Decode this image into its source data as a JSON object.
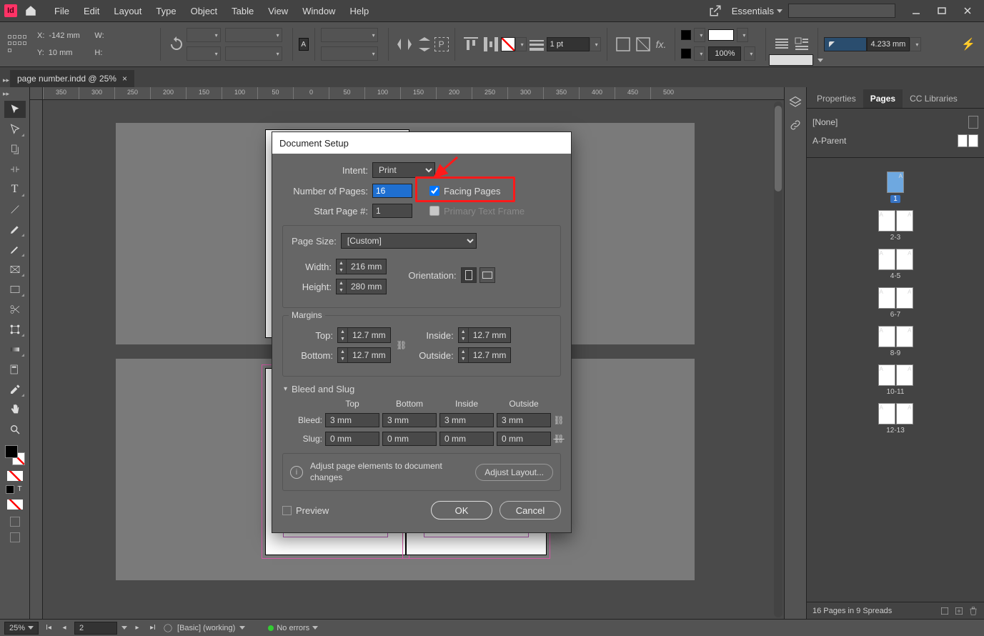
{
  "app": {
    "id_badge": "Id"
  },
  "menu": [
    "File",
    "Edit",
    "Layout",
    "Type",
    "Object",
    "Table",
    "View",
    "Window",
    "Help"
  ],
  "workspace": {
    "label": "Essentials"
  },
  "optbar": {
    "x_lbl": "X:",
    "x_val": "-142 mm",
    "y_lbl": "Y:",
    "y_val": "10 mm",
    "w_lbl": "W:",
    "w_val": "",
    "h_lbl": "H:",
    "h_val": "",
    "stroke": "1 pt",
    "zoom": "100%",
    "num": "4.233 mm"
  },
  "doc_tab": {
    "title": "page number.indd @ 25%"
  },
  "ruler_ticks": [
    "350",
    "300",
    "250",
    "200",
    "150",
    "100",
    "50",
    "0",
    "50",
    "100",
    "150",
    "200",
    "250",
    "300",
    "350",
    "400",
    "450",
    "500"
  ],
  "dialog": {
    "title": "Document Setup",
    "intent_lbl": "Intent:",
    "intent": "Print",
    "npages_lbl": "Number of Pages:",
    "npages": "16",
    "facing_lbl": "Facing Pages",
    "start_lbl": "Start Page #:",
    "start": "1",
    "ptf_lbl": "Primary Text Frame",
    "psize_legend": "Page Size:",
    "psize": "[Custom]",
    "width_lbl": "Width:",
    "width": "216 mm",
    "height_lbl": "Height:",
    "height": "280 mm",
    "orient_lbl": "Orientation:",
    "margins_legend": "Margins",
    "top_lbl": "Top:",
    "top": "12.7 mm",
    "bottom_lbl": "Bottom:",
    "bottom": "12.7 mm",
    "inside_lbl": "Inside:",
    "inside": "12.7 mm",
    "outside_lbl": "Outside:",
    "outside": "12.7 mm",
    "bs_legend": "Bleed and Slug",
    "bs_top": "Top",
    "bs_bottom": "Bottom",
    "bs_inside": "Inside",
    "bs_outside": "Outside",
    "bleed_lbl": "Bleed:",
    "bleed_t": "3 mm",
    "bleed_b": "3 mm",
    "bleed_i": "3 mm",
    "bleed_o": "3 mm",
    "slug_lbl": "Slug:",
    "slug_t": "0 mm",
    "slug_b": "0 mm",
    "slug_i": "0 mm",
    "slug_o": "0 mm",
    "adjust_text": "Adjust page elements to document changes",
    "adjust_btn": "Adjust Layout...",
    "preview": "Preview",
    "ok": "OK",
    "cancel": "Cancel"
  },
  "rightpanel": {
    "tabs": [
      "Properties",
      "Pages",
      "CC Libraries"
    ],
    "master_none": "[None]",
    "master_a": "A-Parent",
    "spreads": [
      "1",
      "2-3",
      "4-5",
      "6-7",
      "8-9",
      "10-11",
      "12-13"
    ],
    "footer": "16 Pages in 9 Spreads"
  },
  "statusbar": {
    "zoom": "25%",
    "page": "2",
    "preset": "[Basic] (working)",
    "errors": "No errors"
  }
}
